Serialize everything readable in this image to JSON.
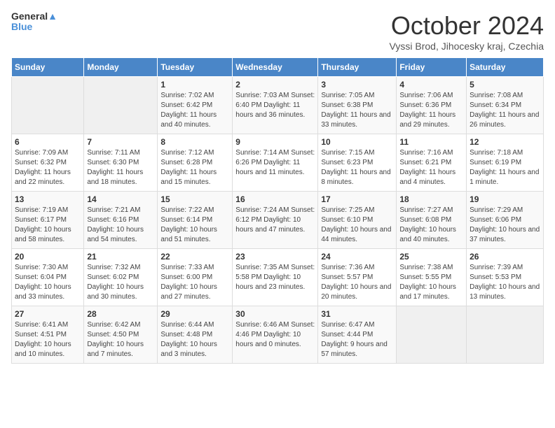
{
  "logo": {
    "line1": "General",
    "line2": "Blue"
  },
  "title": "October 2024",
  "subtitle": "Vyssi Brod, Jihocesky kraj, Czechia",
  "weekdays": [
    "Sunday",
    "Monday",
    "Tuesday",
    "Wednesday",
    "Thursday",
    "Friday",
    "Saturday"
  ],
  "weeks": [
    [
      {
        "day": "",
        "detail": ""
      },
      {
        "day": "",
        "detail": ""
      },
      {
        "day": "1",
        "detail": "Sunrise: 7:02 AM\nSunset: 6:42 PM\nDaylight: 11 hours\nand 40 minutes."
      },
      {
        "day": "2",
        "detail": "Sunrise: 7:03 AM\nSunset: 6:40 PM\nDaylight: 11 hours\nand 36 minutes."
      },
      {
        "day": "3",
        "detail": "Sunrise: 7:05 AM\nSunset: 6:38 PM\nDaylight: 11 hours\nand 33 minutes."
      },
      {
        "day": "4",
        "detail": "Sunrise: 7:06 AM\nSunset: 6:36 PM\nDaylight: 11 hours\nand 29 minutes."
      },
      {
        "day": "5",
        "detail": "Sunrise: 7:08 AM\nSunset: 6:34 PM\nDaylight: 11 hours\nand 26 minutes."
      }
    ],
    [
      {
        "day": "6",
        "detail": "Sunrise: 7:09 AM\nSunset: 6:32 PM\nDaylight: 11 hours\nand 22 minutes."
      },
      {
        "day": "7",
        "detail": "Sunrise: 7:11 AM\nSunset: 6:30 PM\nDaylight: 11 hours\nand 18 minutes."
      },
      {
        "day": "8",
        "detail": "Sunrise: 7:12 AM\nSunset: 6:28 PM\nDaylight: 11 hours\nand 15 minutes."
      },
      {
        "day": "9",
        "detail": "Sunrise: 7:14 AM\nSunset: 6:26 PM\nDaylight: 11 hours\nand 11 minutes."
      },
      {
        "day": "10",
        "detail": "Sunrise: 7:15 AM\nSunset: 6:23 PM\nDaylight: 11 hours\nand 8 minutes."
      },
      {
        "day": "11",
        "detail": "Sunrise: 7:16 AM\nSunset: 6:21 PM\nDaylight: 11 hours\nand 4 minutes."
      },
      {
        "day": "12",
        "detail": "Sunrise: 7:18 AM\nSunset: 6:19 PM\nDaylight: 11 hours\nand 1 minute."
      }
    ],
    [
      {
        "day": "13",
        "detail": "Sunrise: 7:19 AM\nSunset: 6:17 PM\nDaylight: 10 hours\nand 58 minutes."
      },
      {
        "day": "14",
        "detail": "Sunrise: 7:21 AM\nSunset: 6:16 PM\nDaylight: 10 hours\nand 54 minutes."
      },
      {
        "day": "15",
        "detail": "Sunrise: 7:22 AM\nSunset: 6:14 PM\nDaylight: 10 hours\nand 51 minutes."
      },
      {
        "day": "16",
        "detail": "Sunrise: 7:24 AM\nSunset: 6:12 PM\nDaylight: 10 hours\nand 47 minutes."
      },
      {
        "day": "17",
        "detail": "Sunrise: 7:25 AM\nSunset: 6:10 PM\nDaylight: 10 hours\nand 44 minutes."
      },
      {
        "day": "18",
        "detail": "Sunrise: 7:27 AM\nSunset: 6:08 PM\nDaylight: 10 hours\nand 40 minutes."
      },
      {
        "day": "19",
        "detail": "Sunrise: 7:29 AM\nSunset: 6:06 PM\nDaylight: 10 hours\nand 37 minutes."
      }
    ],
    [
      {
        "day": "20",
        "detail": "Sunrise: 7:30 AM\nSunset: 6:04 PM\nDaylight: 10 hours\nand 33 minutes."
      },
      {
        "day": "21",
        "detail": "Sunrise: 7:32 AM\nSunset: 6:02 PM\nDaylight: 10 hours\nand 30 minutes."
      },
      {
        "day": "22",
        "detail": "Sunrise: 7:33 AM\nSunset: 6:00 PM\nDaylight: 10 hours\nand 27 minutes."
      },
      {
        "day": "23",
        "detail": "Sunrise: 7:35 AM\nSunset: 5:58 PM\nDaylight: 10 hours\nand 23 minutes."
      },
      {
        "day": "24",
        "detail": "Sunrise: 7:36 AM\nSunset: 5:57 PM\nDaylight: 10 hours\nand 20 minutes."
      },
      {
        "day": "25",
        "detail": "Sunrise: 7:38 AM\nSunset: 5:55 PM\nDaylight: 10 hours\nand 17 minutes."
      },
      {
        "day": "26",
        "detail": "Sunrise: 7:39 AM\nSunset: 5:53 PM\nDaylight: 10 hours\nand 13 minutes."
      }
    ],
    [
      {
        "day": "27",
        "detail": "Sunrise: 6:41 AM\nSunset: 4:51 PM\nDaylight: 10 hours\nand 10 minutes."
      },
      {
        "day": "28",
        "detail": "Sunrise: 6:42 AM\nSunset: 4:50 PM\nDaylight: 10 hours\nand 7 minutes."
      },
      {
        "day": "29",
        "detail": "Sunrise: 6:44 AM\nSunset: 4:48 PM\nDaylight: 10 hours\nand 3 minutes."
      },
      {
        "day": "30",
        "detail": "Sunrise: 6:46 AM\nSunset: 4:46 PM\nDaylight: 10 hours\nand 0 minutes."
      },
      {
        "day": "31",
        "detail": "Sunrise: 6:47 AM\nSunset: 4:44 PM\nDaylight: 9 hours\nand 57 minutes."
      },
      {
        "day": "",
        "detail": ""
      },
      {
        "day": "",
        "detail": ""
      }
    ]
  ]
}
